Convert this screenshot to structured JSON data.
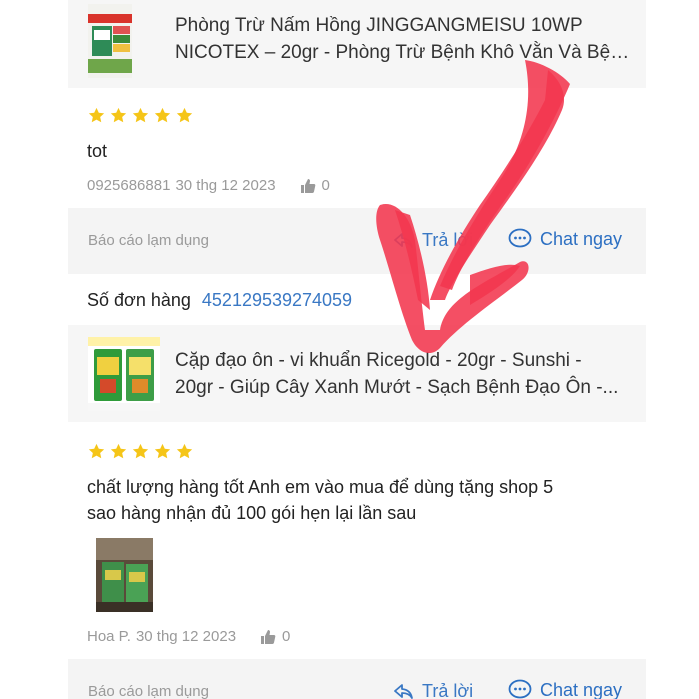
{
  "product1": {
    "thumb_text": [
      "Phòng - Trị Hiệu Quả",
      "NẤM HỒNG - ĐỐM VẰN",
      "Độ độc thấp",
      "Phun ngừa",
      "Định kỳ",
      "20gr/ 25 lít"
    ],
    "title_line1": "Phòng Trừ Nấm Hồng JINGGANGMEISU 10WP",
    "title_line2": "NICOTEX – 20gr - Phòng Trừ Bệnh Khô Vằn Và Bện..."
  },
  "review1": {
    "rating": 5,
    "text": "tot",
    "user": "0925686881",
    "date": "30 thg 12 2023",
    "likes": "0"
  },
  "actions1": {
    "report_label": "Báo cáo lạm dụng",
    "reply_label": "Trả lời",
    "chat_label": "Chat ngay"
  },
  "order": {
    "label": "Số đơn hàng",
    "number": "452129539274059"
  },
  "product2": {
    "thumb_text": [
      "Cặp Đạo Ôn + Vi Khuẩn",
      "0949 300 688"
    ],
    "title_line1": "Cặp đạo ôn - vi khuẩn Ricegold - 20gr - Sunshi -",
    "title_line2": "20gr - Giúp Cây Xanh Mướt - Sạch Bệnh Đạo Ôn -..."
  },
  "review2": {
    "rating": 5,
    "text_line1": "chất lượng hàng tốt Anh em vào mua để dùng tặng shop 5",
    "text_line2": "sao hàng nhận đủ 100 gói hẹn lại lần sau",
    "user": "Hoa P.",
    "date": "30 thg 12 2023",
    "likes": "0"
  },
  "actions2": {
    "report_label": "Báo cáo lạm dụng",
    "reply_label": "Trả lời",
    "chat_label": "Chat ngay"
  },
  "colors": {
    "star": "#f5c518",
    "link": "#3a78c4",
    "arrow": "#f2374f"
  },
  "icons": [
    "star-icon",
    "thumbs-up-icon",
    "reply-arrow-icon",
    "chat-bubble-icon",
    "red-arrow-annotation"
  ]
}
